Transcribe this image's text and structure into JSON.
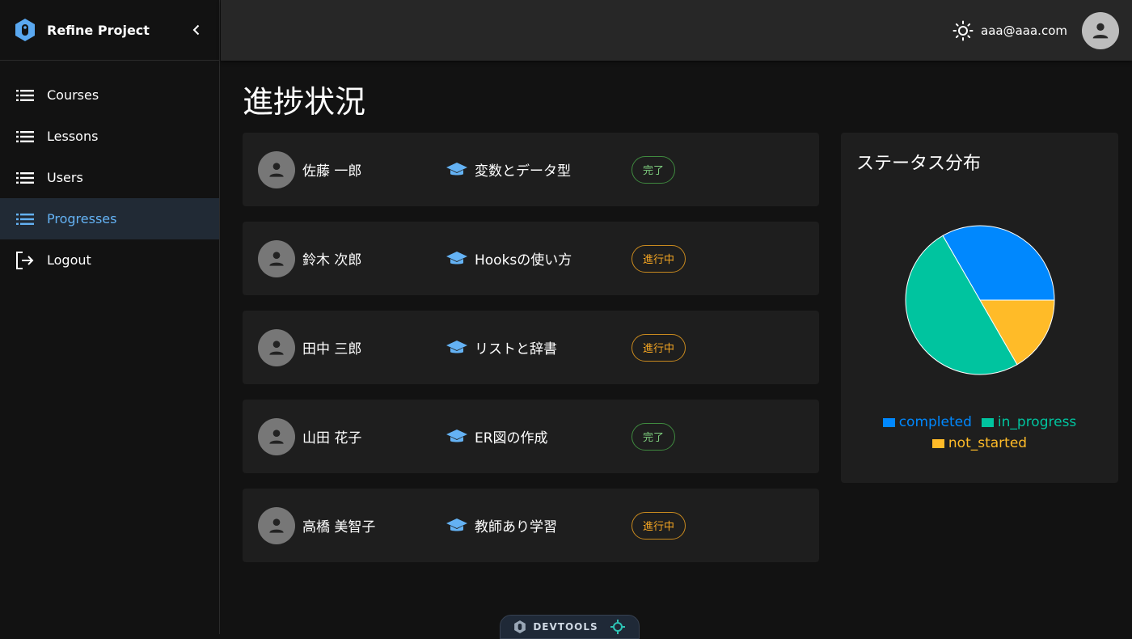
{
  "brand": {
    "title": "Refine Project"
  },
  "sidebar": {
    "items": [
      {
        "label": "Courses",
        "icon": "list-icon",
        "active": false
      },
      {
        "label": "Lessons",
        "icon": "list-icon",
        "active": false
      },
      {
        "label": "Users",
        "icon": "list-icon",
        "active": false
      },
      {
        "label": "Progresses",
        "icon": "list-icon",
        "active": true
      },
      {
        "label": "Logout",
        "icon": "logout-icon",
        "active": false
      }
    ]
  },
  "header": {
    "user_email": "aaa@aaa.com"
  },
  "main": {
    "title": "進捗状況",
    "rows": [
      {
        "user": "佐藤 一郎",
        "lesson": "変数とデータ型",
        "status": "完了",
        "kind": "done"
      },
      {
        "user": "鈴木 次郎",
        "lesson": "Hooksの使い方",
        "status": "進行中",
        "kind": "prog"
      },
      {
        "user": "田中 三郎",
        "lesson": "リストと辞書",
        "status": "進行中",
        "kind": "prog"
      },
      {
        "user": "山田 花子",
        "lesson": "ER図の作成",
        "status": "完了",
        "kind": "done"
      },
      {
        "user": "高橋 美智子",
        "lesson": "教師あり学習",
        "status": "進行中",
        "kind": "prog"
      }
    ]
  },
  "status_card": {
    "title": "ステータス分布"
  },
  "chart_data": {
    "type": "pie",
    "title": "ステータス分布",
    "series": [
      {
        "name": "completed",
        "value": 2,
        "color": "#0088fe"
      },
      {
        "name": "in_progress",
        "value": 3,
        "color": "#00c49f"
      },
      {
        "name": "not_started",
        "value": 1,
        "color": "#ffbb28"
      }
    ],
    "legend": "bottom"
  },
  "devtools": {
    "label": "DEVTOOLS"
  },
  "colors": {
    "accent": "#64b2f4",
    "done": "#7fcf7f",
    "progress": "#f5a623"
  }
}
